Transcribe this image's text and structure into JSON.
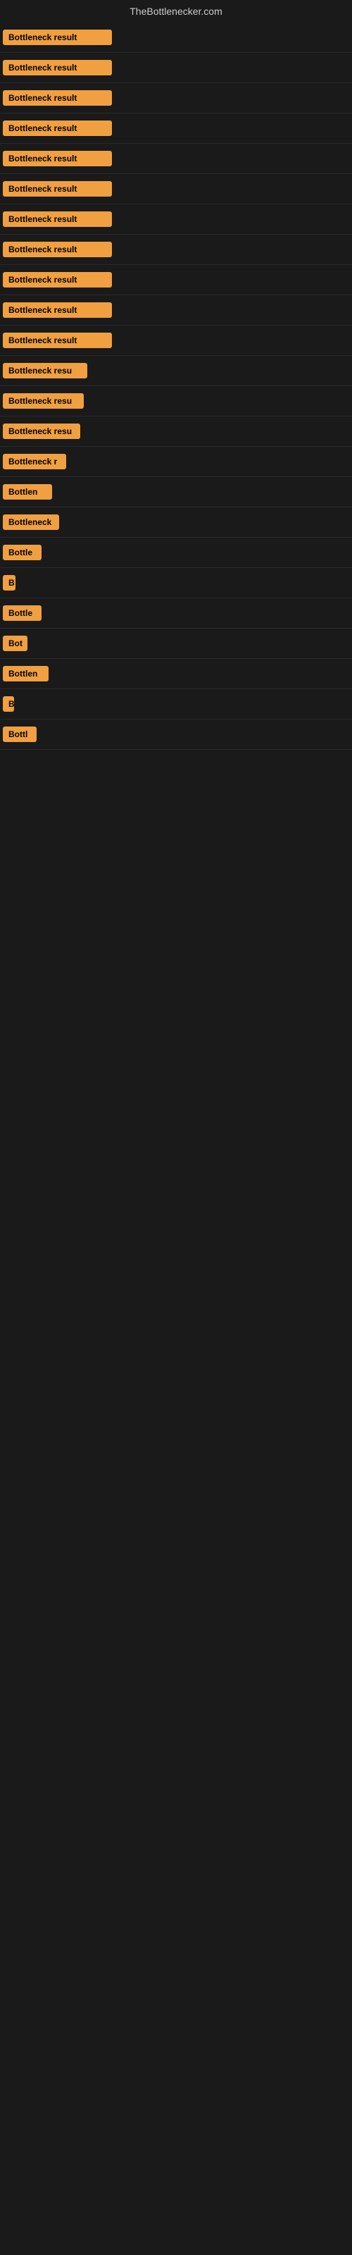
{
  "site": {
    "title": "TheBottlenecker.com"
  },
  "rows": [
    {
      "id": 1,
      "label": "Bottleneck result",
      "width": 155
    },
    {
      "id": 2,
      "label": "Bottleneck result",
      "width": 155
    },
    {
      "id": 3,
      "label": "Bottleneck result",
      "width": 155
    },
    {
      "id": 4,
      "label": "Bottleneck result",
      "width": 155
    },
    {
      "id": 5,
      "label": "Bottleneck result",
      "width": 155
    },
    {
      "id": 6,
      "label": "Bottleneck result",
      "width": 155
    },
    {
      "id": 7,
      "label": "Bottleneck result",
      "width": 155
    },
    {
      "id": 8,
      "label": "Bottleneck result",
      "width": 155
    },
    {
      "id": 9,
      "label": "Bottleneck result",
      "width": 155
    },
    {
      "id": 10,
      "label": "Bottleneck result",
      "width": 155
    },
    {
      "id": 11,
      "label": "Bottleneck result",
      "width": 155
    },
    {
      "id": 12,
      "label": "Bottleneck resu",
      "width": 120
    },
    {
      "id": 13,
      "label": "Bottleneck resu",
      "width": 115
    },
    {
      "id": 14,
      "label": "Bottleneck resu",
      "width": 110
    },
    {
      "id": 15,
      "label": "Bottleneck r",
      "width": 90
    },
    {
      "id": 16,
      "label": "Bottlen",
      "width": 70
    },
    {
      "id": 17,
      "label": "Bottleneck",
      "width": 80
    },
    {
      "id": 18,
      "label": "Bottle",
      "width": 55
    },
    {
      "id": 19,
      "label": "B",
      "width": 18
    },
    {
      "id": 20,
      "label": "Bottle",
      "width": 55
    },
    {
      "id": 21,
      "label": "Bot",
      "width": 35
    },
    {
      "id": 22,
      "label": "Bottlen",
      "width": 65
    },
    {
      "id": 23,
      "label": "B",
      "width": 14
    },
    {
      "id": 24,
      "label": "Bottl",
      "width": 48
    }
  ],
  "colors": {
    "badge_bg": "#f0a040",
    "badge_text": "#000000",
    "body_bg": "#1a1a1a",
    "title_text": "#cccccc"
  }
}
